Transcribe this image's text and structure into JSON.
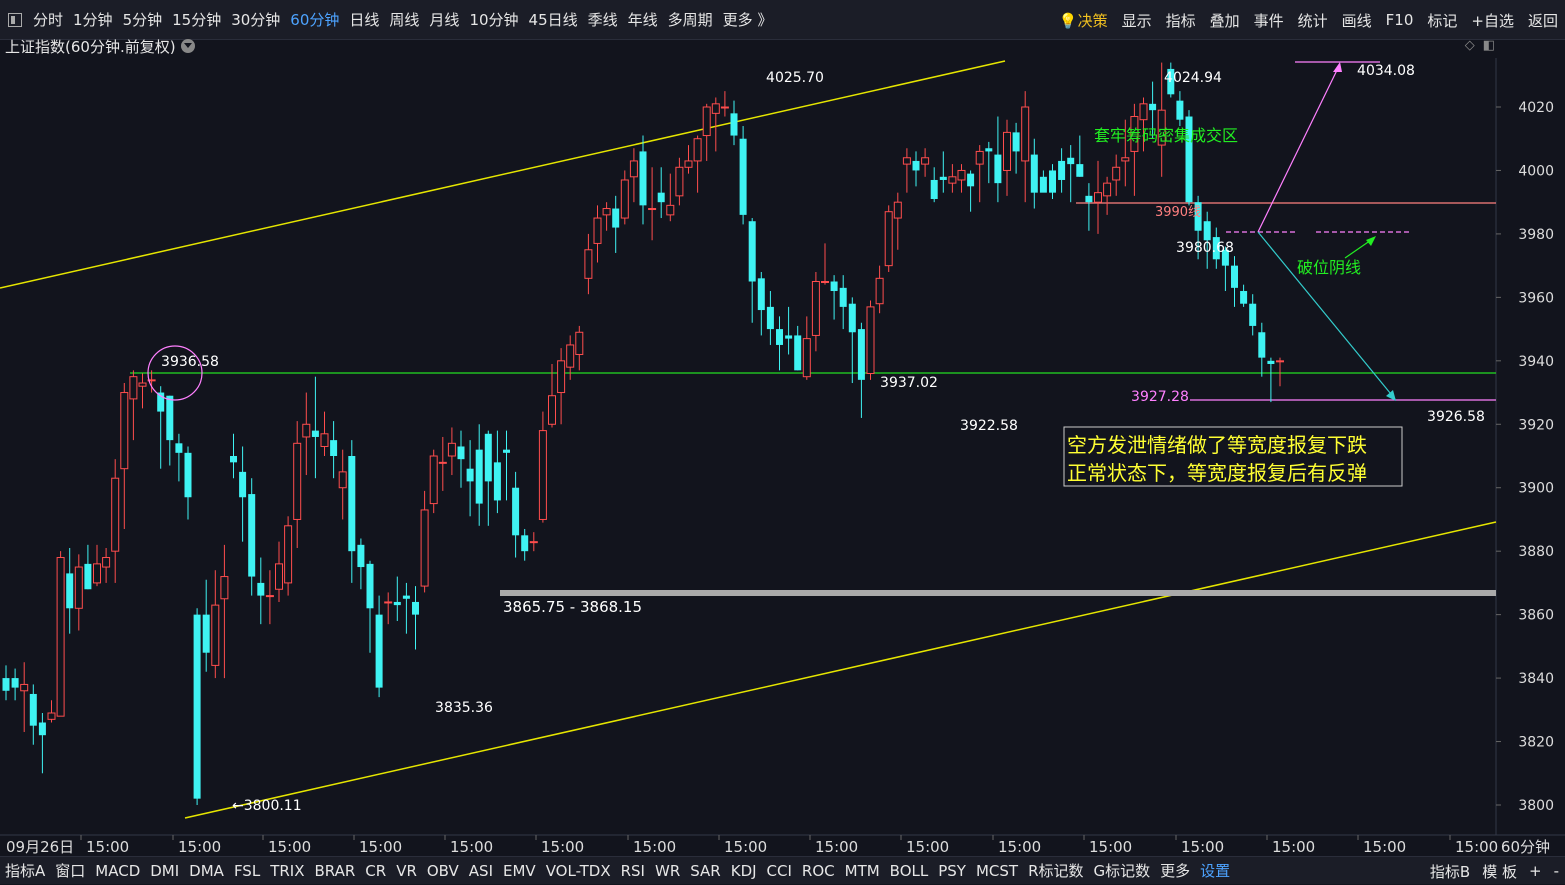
{
  "toolbar": {
    "periods": [
      "分时",
      "1分钟",
      "5分钟",
      "15分钟",
      "30分钟",
      "60分钟",
      "日线",
      "周线",
      "月线",
      "10分钟",
      "45日线",
      "季线",
      "年线",
      "多周期",
      "更多 》"
    ],
    "active_period": "60分钟",
    "right_items": [
      "决策",
      "显示",
      "指标",
      "叠加",
      "事件",
      "统计",
      "画线",
      "F10",
      "标记",
      "+自选",
      "返回"
    ]
  },
  "subtitle": "上证指数(60分钟.前复权)",
  "chart_data": {
    "type": "candlestick",
    "y_axis_ticks": [
      4020,
      4000,
      3980,
      3960,
      3940,
      3920,
      3900,
      3880,
      3860,
      3840,
      3820,
      3800
    ],
    "x_axis_ticks": [
      "09月26日",
      "15:00",
      "15:00",
      "15:00",
      "15:00",
      "15:00",
      "15:00",
      "15:00",
      "15:00",
      "15:00",
      "15:00",
      "15:00",
      "15:00",
      "15:00",
      "15:00",
      "15:00",
      "15:00"
    ],
    "period_label": "60分钟",
    "colors": {
      "up": "#ff4d4d",
      "down": "#3ff3f3",
      "trend": "#e6e600",
      "support": "#22dd22",
      "zone": "#aaaaaa",
      "pink": "#ff80ff",
      "salmon": "#ff8080",
      "note": "#ffff33",
      "green_text": "#22ee22"
    },
    "candles": [
      [
        3840,
        3836,
        3844,
        3833
      ],
      [
        3840,
        3837,
        3843,
        3833
      ],
      [
        3836,
        3838,
        3845,
        3823
      ],
      [
        3835,
        3825,
        3838,
        3819
      ],
      [
        3826,
        3822,
        3829,
        3810
      ],
      [
        3827,
        3829,
        3833,
        3826
      ],
      [
        3828,
        3878,
        3880,
        3828
      ],
      [
        3873,
        3862,
        3881,
        3854
      ],
      [
        3862,
        3875,
        3879,
        3855
      ],
      [
        3876,
        3868,
        3882,
        3868
      ],
      [
        3870,
        3876,
        3882,
        3869
      ],
      [
        3875,
        3878,
        3881,
        3870
      ],
      [
        3880,
        3903,
        3909,
        3870
      ],
      [
        3906,
        3930,
        3933,
        3887
      ],
      [
        3928,
        3935,
        3937,
        3915
      ],
      [
        3932,
        3933,
        3936,
        3925
      ],
      [
        3934,
        3934,
        3937,
        3930
      ],
      [
        3930,
        3924,
        3932,
        3906
      ],
      [
        3929,
        3915,
        3929,
        3907
      ],
      [
        3914,
        3911,
        3917,
        3902
      ],
      [
        3911,
        3897,
        3913,
        3890
      ],
      [
        3860,
        3802,
        3862,
        3800
      ],
      [
        3860,
        3848,
        3871,
        3842
      ],
      [
        3844,
        3863,
        3874,
        3840
      ],
      [
        3865,
        3872,
        3882,
        3840
      ],
      [
        3910,
        3908,
        3917,
        3903
      ],
      [
        3905,
        3897,
        3913,
        3883
      ],
      [
        3898,
        3872,
        3903,
        3866
      ],
      [
        3870,
        3866,
        3878,
        3857
      ],
      [
        3866,
        3866,
        3874,
        3857
      ],
      [
        3868,
        3876,
        3883,
        3864
      ],
      [
        3870,
        3888,
        3891,
        3866
      ],
      [
        3890,
        3914,
        3921,
        3881
      ],
      [
        3916,
        3920,
        3930,
        3904
      ],
      [
        3918,
        3916,
        3935,
        3903
      ],
      [
        3913,
        3917,
        3924,
        3910
      ],
      [
        3915,
        3910,
        3921,
        3903
      ],
      [
        3900,
        3905,
        3912,
        3890
      ],
      [
        3910,
        3880,
        3915,
        3870
      ],
      [
        3882,
        3875,
        3884,
        3868
      ],
      [
        3876,
        3862,
        3877,
        3848
      ],
      [
        3860,
        3837,
        3866,
        3834
      ],
      [
        3864,
        3864,
        3867,
        3857
      ],
      [
        3864,
        3863,
        3872,
        3858
      ],
      [
        3866,
        3865,
        3870,
        3854
      ],
      [
        3864,
        3860,
        3869,
        3849
      ],
      [
        3869,
        3893,
        3899,
        3867
      ],
      [
        3895,
        3910,
        3912,
        3892
      ],
      [
        3908,
        3908,
        3916,
        3899
      ],
      [
        3910,
        3914,
        3919,
        3904
      ],
      [
        3913,
        3909,
        3918,
        3900
      ],
      [
        3906,
        3902,
        3915,
        3891
      ],
      [
        3912,
        3895,
        3920,
        3888
      ],
      [
        3917,
        3902,
        3918,
        3888
      ],
      [
        3908,
        3896,
        3918,
        3892
      ],
      [
        3912,
        3911,
        3918,
        3896
      ],
      [
        3900,
        3885,
        3905,
        3878
      ],
      [
        3885,
        3880,
        3887,
        3877
      ],
      [
        3883,
        3883,
        3886,
        3880
      ],
      [
        3890,
        3918,
        3924,
        3889
      ],
      [
        3920,
        3929,
        3939,
        3919
      ],
      [
        3930,
        3940,
        3944,
        3920
      ],
      [
        3938,
        3945,
        3948,
        3934
      ],
      [
        3942,
        3949,
        3951,
        3937
      ],
      [
        3966,
        3975,
        3980,
        3961
      ],
      [
        3977,
        3985,
        3989,
        3971
      ],
      [
        3986,
        3988,
        3990,
        3981
      ],
      [
        3988,
        3982,
        3992,
        3974
      ],
      [
        3985,
        3997,
        4000,
        3983
      ],
      [
        3998,
        4003,
        4007,
        3990
      ],
      [
        4006,
        3989,
        4011,
        3983
      ],
      [
        3988,
        3988,
        4001,
        3978
      ],
      [
        3993,
        3990,
        4001,
        3985
      ],
      [
        3986,
        3989,
        3999,
        3984
      ],
      [
        3992,
        4001,
        4004,
        3989
      ],
      [
        4001,
        4003,
        4008,
        3999
      ],
      [
        4003,
        4010,
        4011,
        3993
      ],
      [
        4011,
        4020,
        4021,
        4003
      ],
      [
        4018,
        4021,
        4023,
        4006
      ],
      [
        4020,
        4020,
        4025,
        4017
      ],
      [
        4018,
        4011,
        4022,
        4008
      ],
      [
        4010,
        3986,
        4014,
        3983
      ],
      [
        3984,
        3965,
        3985,
        3952
      ],
      [
        3966,
        3956,
        3968,
        3948
      ],
      [
        3957,
        3950,
        3962,
        3945
      ],
      [
        3950,
        3945,
        3954,
        3937
      ],
      [
        3948,
        3947,
        3957,
        3942
      ],
      [
        3948,
        3937,
        3951,
        3937
      ],
      [
        3935,
        3947,
        3954,
        3934
      ],
      [
        3948,
        3965,
        3968,
        3943
      ],
      [
        3965,
        3965,
        3977,
        3964
      ],
      [
        3965,
        3962,
        3967,
        3953
      ],
      [
        3963,
        3957,
        3967,
        3950
      ],
      [
        3958,
        3949,
        3960,
        3933
      ],
      [
        3950,
        3934,
        3952,
        3922
      ],
      [
        3936,
        3957,
        3959,
        3934
      ],
      [
        3958,
        3966,
        3970,
        3955
      ],
      [
        3970,
        3987,
        3989,
        3968
      ],
      [
        3985,
        3990,
        3993,
        3975
      ],
      [
        4002,
        4004,
        4007,
        3993
      ],
      [
        4003,
        4000,
        4006,
        3995
      ],
      [
        4002,
        4004,
        4007,
        3998
      ],
      [
        3997,
        3991,
        4001,
        3990
      ],
      [
        3998,
        3997,
        4006,
        3993
      ],
      [
        3996,
        3998,
        4002,
        3993
      ],
      [
        3997,
        4000,
        4002,
        3993
      ],
      [
        3999,
        3995,
        4000,
        3987
      ],
      [
        4002,
        4006,
        4008,
        3990
      ],
      [
        4007,
        4006,
        4009,
        3996
      ],
      [
        4005,
        3996,
        4017,
        3990
      ],
      [
        4000,
        4012,
        4016,
        3992
      ],
      [
        4012,
        4006,
        4015,
        3999
      ],
      [
        4003,
        4020,
        4025,
        3990
      ],
      [
        4005,
        3993,
        4010,
        3988
      ],
      [
        3998,
        3993,
        4000,
        3995
      ],
      [
        4000,
        3993,
        4002,
        3991
      ],
      [
        4003,
        3997,
        4007,
        3993
      ],
      [
        4004,
        4002,
        4008,
        3990
      ],
      [
        4002,
        3998,
        4011,
        3998
      ],
      [
        3992,
        3990,
        3996,
        3981
      ],
      [
        3990,
        3993,
        4003,
        3980
      ],
      [
        3992,
        3996,
        3998,
        3986
      ],
      [
        3997,
        4001,
        4005,
        3992
      ],
      [
        4003,
        4004,
        4016,
        3995
      ],
      [
        4006,
        4017,
        4021,
        3992
      ],
      [
        4016,
        4021,
        4023,
        4006
      ],
      [
        4021,
        4019,
        4028,
        4010
      ],
      [
        4008,
        4019,
        4034,
        3998
      ],
      [
        4032,
        4024,
        4034,
        4023
      ],
      [
        4022,
        4016,
        4025,
        4014
      ],
      [
        4017,
        3990,
        4019,
        3989
      ],
      [
        3990,
        3981,
        3992,
        3972
      ],
      [
        3984,
        3978,
        3987,
        3969
      ],
      [
        3979,
        3972,
        3982,
        3969
      ],
      [
        3975,
        3970,
        3976,
        3962
      ],
      [
        3970,
        3963,
        3973,
        3957
      ],
      [
        3962,
        3958,
        3964,
        3957
      ],
      [
        3958,
        3951,
        3961,
        3948
      ],
      [
        3949,
        3941,
        3952,
        3935
      ],
      [
        3940,
        3939,
        3941,
        3927
      ],
      [
        3940,
        3940,
        3941,
        3932
      ]
    ],
    "annotations": {
      "label_4025": "4025.70",
      "label_4024": "4024.94",
      "label_4034": "4034.08",
      "label_3936": "3936.58",
      "label_3937": "3937.02",
      "label_3922": "3922.58",
      "label_3926": "3926.58",
      "label_3927": "3927.28",
      "label_3980": "3980.68",
      "label_3835": "3835.36",
      "label_3800": "3800.11",
      "zone_label": "3865.75 - 3868.15",
      "line_3990": "3990线",
      "chip_zone": "套牢筹码密集成交区",
      "break_candle": "破位阴线",
      "note_line1": "空方发泄情绪做了等宽度报复下跌",
      "note_line2": "正常状态下，等宽度报复后有反弹"
    }
  },
  "bottombar": {
    "items": [
      "指标A",
      "窗口",
      "MACD",
      "DMI",
      "DMA",
      "FSL",
      "TRIX",
      "BRAR",
      "CR",
      "VR",
      "OBV",
      "ASI",
      "EMV",
      "VOL-TDX",
      "RSI",
      "WR",
      "SAR",
      "KDJ",
      "CCI",
      "ROC",
      "MTM",
      "BOLL",
      "PSY",
      "MCST",
      "R标记数",
      "G标记数",
      "更多",
      "设置"
    ],
    "active": "设置",
    "right_items": [
      "指标B",
      "模 板",
      "+",
      "-"
    ]
  }
}
